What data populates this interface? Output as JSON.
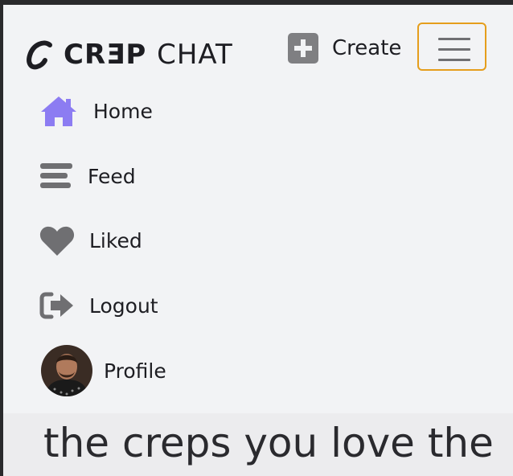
{
  "header": {
    "logo_bold": "CRƎP",
    "logo_light": "CHAT",
    "create_label": "Create",
    "accent_color": "#e59e1c"
  },
  "nav": {
    "items": [
      {
        "label": "Home",
        "icon": "home-icon",
        "color": "#8c7cf2"
      },
      {
        "label": "Feed",
        "icon": "feed-icon"
      },
      {
        "label": "Liked",
        "icon": "heart-icon"
      },
      {
        "label": "Logout",
        "icon": "logout-icon"
      },
      {
        "label": "Profile",
        "icon": "avatar"
      }
    ]
  },
  "hero": {
    "text": "the creps you love the"
  }
}
